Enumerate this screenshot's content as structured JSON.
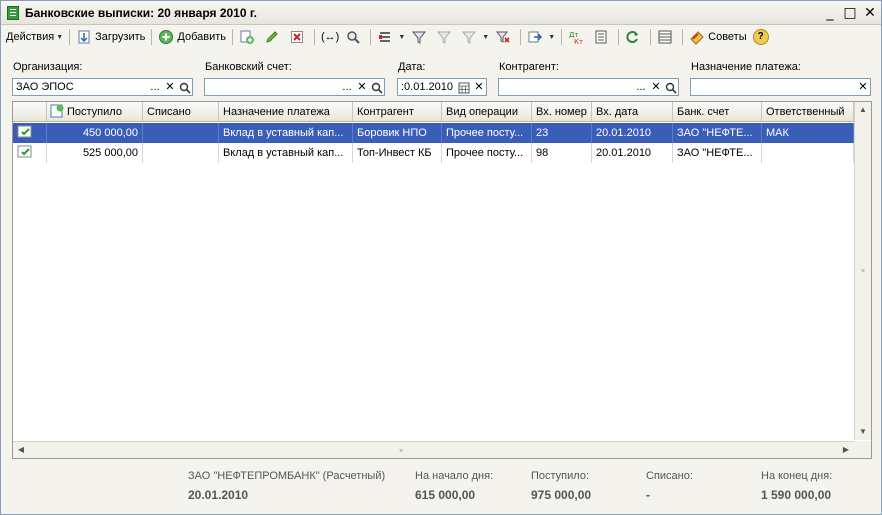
{
  "window": {
    "title": "Банковские выписки: 20 января 2010 г.",
    "minimize": "_",
    "maximize": "□",
    "close": "✕"
  },
  "toolbar": {
    "actions_label": "Действия",
    "load_label": "Загрузить",
    "add_label": "Добавить",
    "tips_label": "Советы",
    "help_glyph": "?",
    "range_glyph": "(↔)"
  },
  "filters": {
    "organization": {
      "label": "Организация:",
      "value": "ЗАО ЭПОС"
    },
    "bank_account": {
      "label": "Банковский счет:",
      "value": ""
    },
    "date": {
      "label": "Дата:",
      "value": ":0.01.2010"
    },
    "counterparty": {
      "label": "Контрагент:",
      "value": ""
    },
    "purpose": {
      "label": "Назначение платежа:",
      "value": ""
    },
    "select_glyph": "...",
    "clear_glyph": "✕"
  },
  "table": {
    "columns": [
      "Поступило",
      "Списано",
      "Назначение платежа",
      "Контрагент",
      "Вид операции",
      "Вх. номер",
      "Вх. дата",
      "Банк. счет",
      "Ответственный"
    ],
    "rows": [
      {
        "received": "450 000,00",
        "spent": "",
        "purpose": "Вклад в уставный кап...",
        "counterparty": "Боровик НПО",
        "operation": "Прочее посту...",
        "in_number": "23",
        "in_date": "20.01.2010",
        "account": "ЗАО \"НЕФТЕ...",
        "responsible": "МАК",
        "selected": true
      },
      {
        "received": "525 000,00",
        "spent": "",
        "purpose": "Вклад в уставный кап...",
        "counterparty": "Топ-Инвест КБ",
        "operation": "Прочее посту...",
        "in_number": "98",
        "in_date": "20.01.2010",
        "account": "ЗАО \"НЕФТЕ...",
        "responsible": "",
        "selected": false
      }
    ]
  },
  "summary": {
    "bank": "ЗАО \"НЕФТЕПРОМБАНК\" (Расчетный)",
    "date": "20.01.2010",
    "start_label": "На начало дня:",
    "start_value": "615 000,00",
    "received_label": "Поступило:",
    "received_value": "975 000,00",
    "spent_label": "Списано:",
    "spent_value": "-",
    "end_label": "На конец дня:",
    "end_value": "1 590 000,00"
  },
  "colors": {
    "selection": "#3a5eb8",
    "window_bg": "#f4f3ee"
  }
}
